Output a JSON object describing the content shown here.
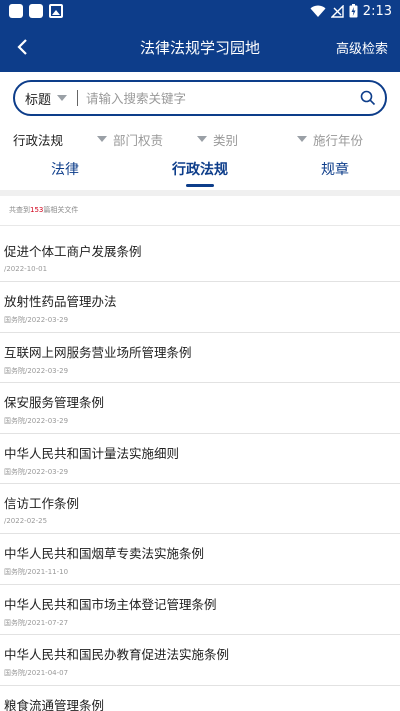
{
  "status_bar": {
    "time": "2:13"
  },
  "appbar": {
    "title": "法律法规学习园地",
    "advanced_search": "高级检索"
  },
  "search": {
    "type": "标题",
    "placeholder": "请输入搜索关键字"
  },
  "filters": [
    "行政法规",
    "部门权责",
    "类别",
    "施行年份"
  ],
  "tabs": [
    {
      "label": "法律",
      "active": false
    },
    {
      "label": "行政法规",
      "active": true
    },
    {
      "label": "规章",
      "active": false
    }
  ],
  "result": {
    "prefix": "共查到",
    "count": "153",
    "suffix": "篇相关文件"
  },
  "items": [
    {
      "title": "促进个体工商户发展条例",
      "meta": "/2022-10-01"
    },
    {
      "title": "放射性药品管理办法",
      "meta": "国务院/2022-03-29"
    },
    {
      "title": "互联网上网服务营业场所管理条例",
      "meta": "国务院/2022-03-29"
    },
    {
      "title": "保安服务管理条例",
      "meta": "国务院/2022-03-29"
    },
    {
      "title": "中华人民共和国计量法实施细则",
      "meta": "国务院/2022-03-29"
    },
    {
      "title": "信访工作条例",
      "meta": "/2022-02-25"
    },
    {
      "title": "中华人民共和国烟草专卖法实施条例",
      "meta": "国务院/2021-11-10"
    },
    {
      "title": "中华人民共和国市场主体登记管理条例",
      "meta": "国务院/2021-07-27"
    },
    {
      "title": "中华人民共和国民办教育促进法实施条例",
      "meta": "国务院/2021-04-07"
    },
    {
      "title": "粮食流通管理条例",
      "meta": ""
    }
  ],
  "colors": {
    "primary": "#0d3d8a",
    "count_highlight": "#d0021b"
  }
}
